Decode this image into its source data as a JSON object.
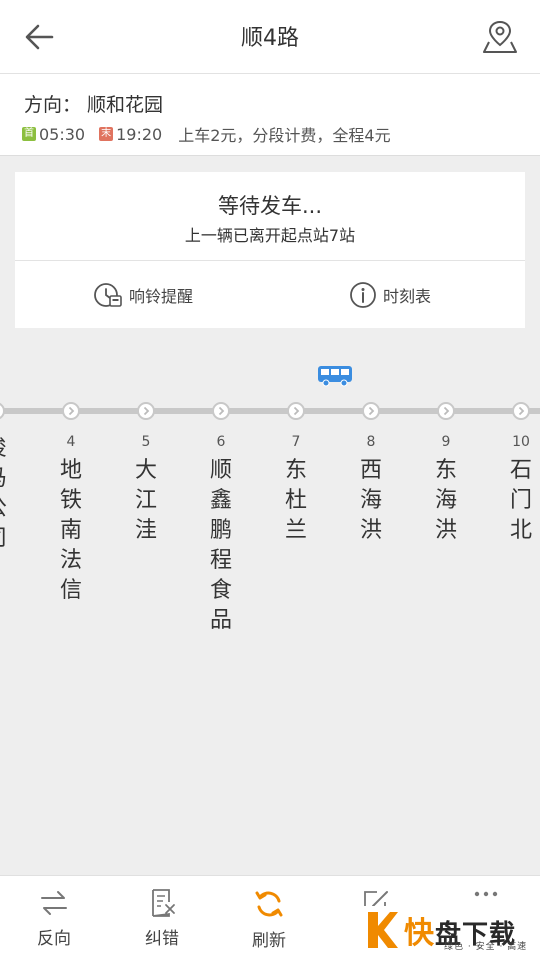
{
  "header": {
    "title": "顺4路"
  },
  "direction": {
    "label": "方向：",
    "value": "顺和花园",
    "first_tag": "首",
    "first_time": "05:30",
    "last_tag": "末",
    "last_time": "19:20",
    "fare": "上车2元，分段计费，全程4元"
  },
  "status": {
    "title": "等待发车...",
    "subtitle": "上一辆已离开起点站7站",
    "alarm_label": "响铃提醒",
    "timetable_label": "时刻表"
  },
  "stops": [
    {
      "num": "",
      "name": "俊马公司"
    },
    {
      "num": "4",
      "name": "地铁南法信"
    },
    {
      "num": "5",
      "name": "大江洼"
    },
    {
      "num": "6",
      "name": "顺鑫鹏程食品"
    },
    {
      "num": "7",
      "name": "东杜兰"
    },
    {
      "num": "8",
      "name": "西海洪"
    },
    {
      "num": "9",
      "name": "东海洪"
    },
    {
      "num": "10",
      "name": "石门北"
    }
  ],
  "bottom_tabs": {
    "reverse": "反向",
    "correct": "纠错",
    "refresh": "刷新",
    "comment": "评"
  },
  "watermark": {
    "quick": "快",
    "rest": "盘下载",
    "tagline": "绿色 · 安全 · 高速"
  },
  "colors": {
    "accent": "#f08a00",
    "bus": "#3b8de0",
    "first_tag": "#8cbf3f",
    "last_tag": "#e0735f"
  }
}
